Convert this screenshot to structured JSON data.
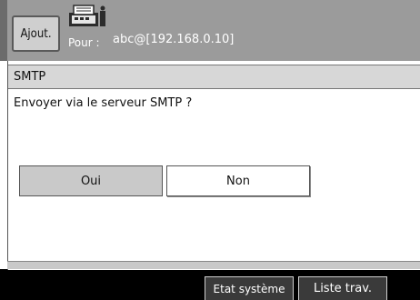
{
  "header": {
    "add_label": "Ajout.",
    "to_label": "Pour :",
    "to_value": "abc@[192.168.0.10]",
    "icon": "fax-machine-icon"
  },
  "dialog": {
    "title": "SMTP",
    "question": "Envoyer via le serveur SMTP ?",
    "yes_label": "Oui",
    "no_label": "Non"
  },
  "footer": {
    "system_status_label": "Etat système",
    "job_list_label": "Liste trav."
  },
  "colors": {
    "header_bg": "#9b9b9b",
    "title_bar_bg": "#d7d7d7",
    "selected_button_bg": "#c9c9c9",
    "footer_bg": "#000000"
  }
}
